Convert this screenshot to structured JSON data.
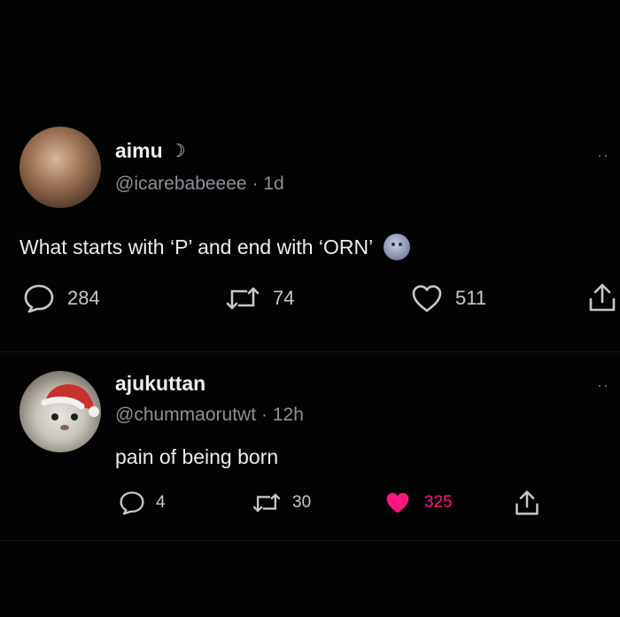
{
  "tweets": [
    {
      "display_name": "aimu",
      "name_emoji": "☽",
      "handle": "@icarebabeeee",
      "time": "· 1d",
      "text": "What starts with ‘P’ and end with ‘ORN’",
      "replies": "284",
      "retweets": "74",
      "likes": "511"
    },
    {
      "display_name": "ajukuttan",
      "handle": "@chummaorutwt",
      "time": "· 12h",
      "text": "pain of being born",
      "replies": "4",
      "retweets": "30",
      "likes": "325"
    }
  ],
  "colors": {
    "background": "#030303",
    "secondary_text": "#8b9097",
    "like_active": "#f91880"
  }
}
